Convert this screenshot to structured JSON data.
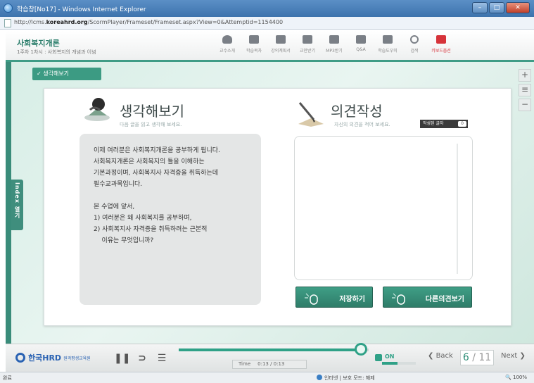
{
  "window": {
    "title": "학습창[No17] - Windows Internet Explorer",
    "url_prefix": "http://lcms.",
    "url_domain": "koreahrd.org",
    "url_suffix": "/ScormPlayer/Frameset/Frameset.aspx?View=0&Attemptid=1154400",
    "buttons": [
      "–",
      "□",
      "✕"
    ]
  },
  "header": {
    "course_title": "사회복지개론",
    "course_subtitle": "1주차 1차시 : 사회복지의 개념과 이념",
    "tools": [
      {
        "label": "교수소개",
        "icon": "professor-icon"
      },
      {
        "label": "학습목차",
        "icon": "contents-icon"
      },
      {
        "label": "강의계획서",
        "icon": "syllabus-icon"
      },
      {
        "label": "교안받기",
        "icon": "download-icon"
      },
      {
        "label": "MP3받기",
        "icon": "mp3-icon"
      },
      {
        "label": "Q&A",
        "icon": "qna-icon"
      },
      {
        "label": "학습도우미",
        "icon": "helper-icon"
      },
      {
        "label": "검색",
        "icon": "search-icon"
      },
      {
        "label": "키보드옵션",
        "icon": "keyboard-icon"
      }
    ]
  },
  "stage": {
    "section_tab": "✓ 생각해보기",
    "index_tab": "Index 열기",
    "side_buttons": [
      "+",
      "≡",
      "−"
    ]
  },
  "think": {
    "title": "생각해보기",
    "subtitle": "다음 글을 읽고 생각해 보세요.",
    "paragraph1": [
      "이제 여러분은 사회복지개론을 공부하게 됩니다.",
      "사회복지개론은 사회복지의 틀을 이해하는",
      "기본과정이며, 사회복지사 자격증을 취득하는데",
      "필수교과목입니다."
    ],
    "paragraph2": [
      "본 수업에 앞서,",
      "1) 여러분은 왜 사회복지를 공부하며,",
      "2) 사회복지사 자격증을 취득하려는 근본적",
      "    이유는 무엇입니까?"
    ]
  },
  "write": {
    "title": "의견작성",
    "subtitle": "자신의 의견을 적어 보세요.",
    "badge": "작성된 글자",
    "badge_toggle": "0",
    "textarea_value": "",
    "save_label": "저장하기",
    "others_label": "다른의견보기"
  },
  "player": {
    "logo_text": "한국HRD",
    "logo_sub": "원격평생교육원",
    "time_label": "Time",
    "time_value": "0:13 / 0:13",
    "progress_fraction": 0.96,
    "sound_label": "ON",
    "volume_fraction": 0.45,
    "back_label": "Back",
    "page_current": "6",
    "page_total": "/ 11",
    "next_label": "Next"
  },
  "statusbar": {
    "left": "완료",
    "zone": "인터넷 | 보호 모드: 해제",
    "zoom": "100%"
  },
  "colors": {
    "accent": "#3f9c86",
    "brand_blue": "#2b63b3",
    "alert_red": "#d6333a"
  }
}
